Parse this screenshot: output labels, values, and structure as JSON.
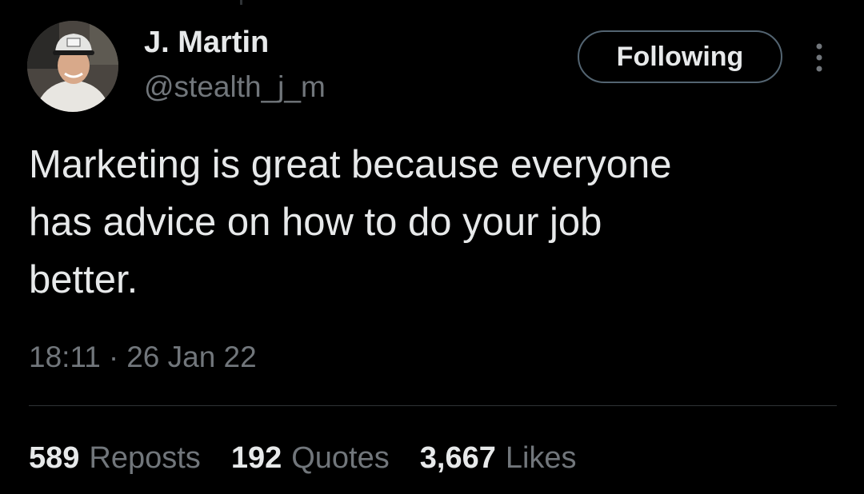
{
  "author": {
    "name": "J. Martin",
    "handle": "@stealth_j_m"
  },
  "follow_button": {
    "label": "Following"
  },
  "tweet": {
    "lines": [
      "Marketing is great because everyone",
      "has advice on how to do your job",
      "better."
    ]
  },
  "meta": {
    "time": "18:11",
    "separator": "·",
    "date": "26 Jan 22"
  },
  "stats": [
    {
      "count": "589",
      "label": "Reposts"
    },
    {
      "count": "192",
      "label": "Quotes"
    },
    {
      "count": "3,667",
      "label": "Likes"
    }
  ],
  "icons": {
    "more": "more-vertical-icon"
  },
  "colors": {
    "background": "#000000",
    "primary_text": "#e7e9ea",
    "secondary_text": "#71767b",
    "border": "#536471",
    "divider": "#2f3336"
  }
}
